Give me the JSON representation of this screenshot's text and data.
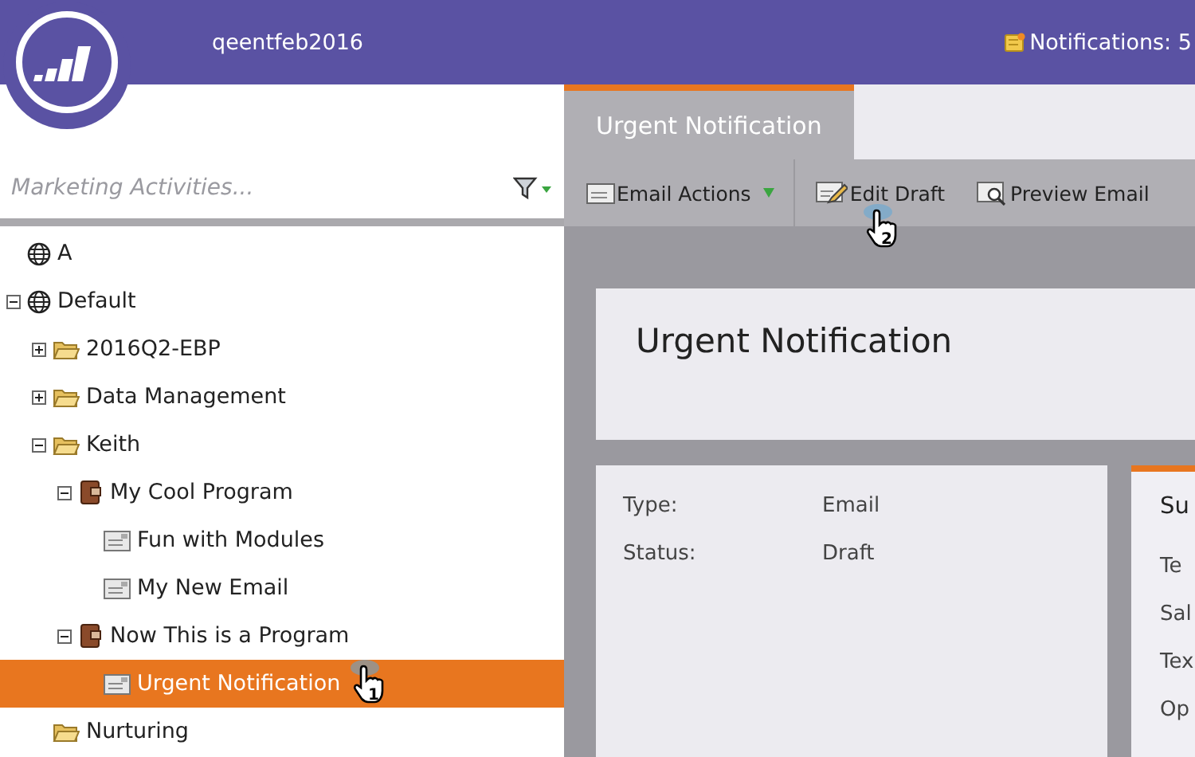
{
  "header": {
    "account": "qeentfeb2016",
    "notifications": "Notifications: 5"
  },
  "sidebar": {
    "search": {
      "placeholder": "Marketing Activities..."
    },
    "tree": [
      {
        "label": "A",
        "kind": "workspace",
        "selected": false
      },
      {
        "label": "Default",
        "kind": "workspace",
        "expanded": true,
        "selected": false,
        "children": [
          {
            "label": "2016Q2-EBP",
            "kind": "folder",
            "expanded": false,
            "selected": false
          },
          {
            "label": "Data Management",
            "kind": "folder",
            "expanded": false,
            "selected": false
          },
          {
            "label": "Keith",
            "kind": "folder",
            "expanded": true,
            "selected": false,
            "children": [
              {
                "label": "My Cool Program",
                "kind": "program",
                "expanded": true,
                "selected": false,
                "children": [
                  {
                    "label": "Fun with Modules",
                    "kind": "email",
                    "selected": false
                  },
                  {
                    "label": "My New Email",
                    "kind": "email",
                    "selected": false
                  }
                ]
              },
              {
                "label": "Now This is a Program",
                "kind": "program",
                "expanded": true,
                "selected": false,
                "children": [
                  {
                    "label": "Urgent Notification",
                    "kind": "email",
                    "selected": true,
                    "callout": "1"
                  }
                ]
              }
            ]
          },
          {
            "label": "Nurturing",
            "kind": "folder",
            "selected": false
          }
        ]
      }
    ]
  },
  "tabs": [
    {
      "label": "Urgent Notification",
      "selected": true
    }
  ],
  "toolbar": [
    {
      "label": "Email Actions",
      "kind": "menu"
    },
    {
      "label": "Edit Draft",
      "kind": "edit",
      "callout": "2"
    },
    {
      "label": "Preview Email",
      "kind": "preview"
    }
  ],
  "title": "Urgent Notification",
  "details": [
    {
      "label": "Type:",
      "value": "Email"
    },
    {
      "label": "Status:",
      "value": "Draft"
    }
  ],
  "side_card": {
    "heading": "Su",
    "rows": [
      "Te",
      "Sal",
      "Tex",
      "Op"
    ]
  }
}
